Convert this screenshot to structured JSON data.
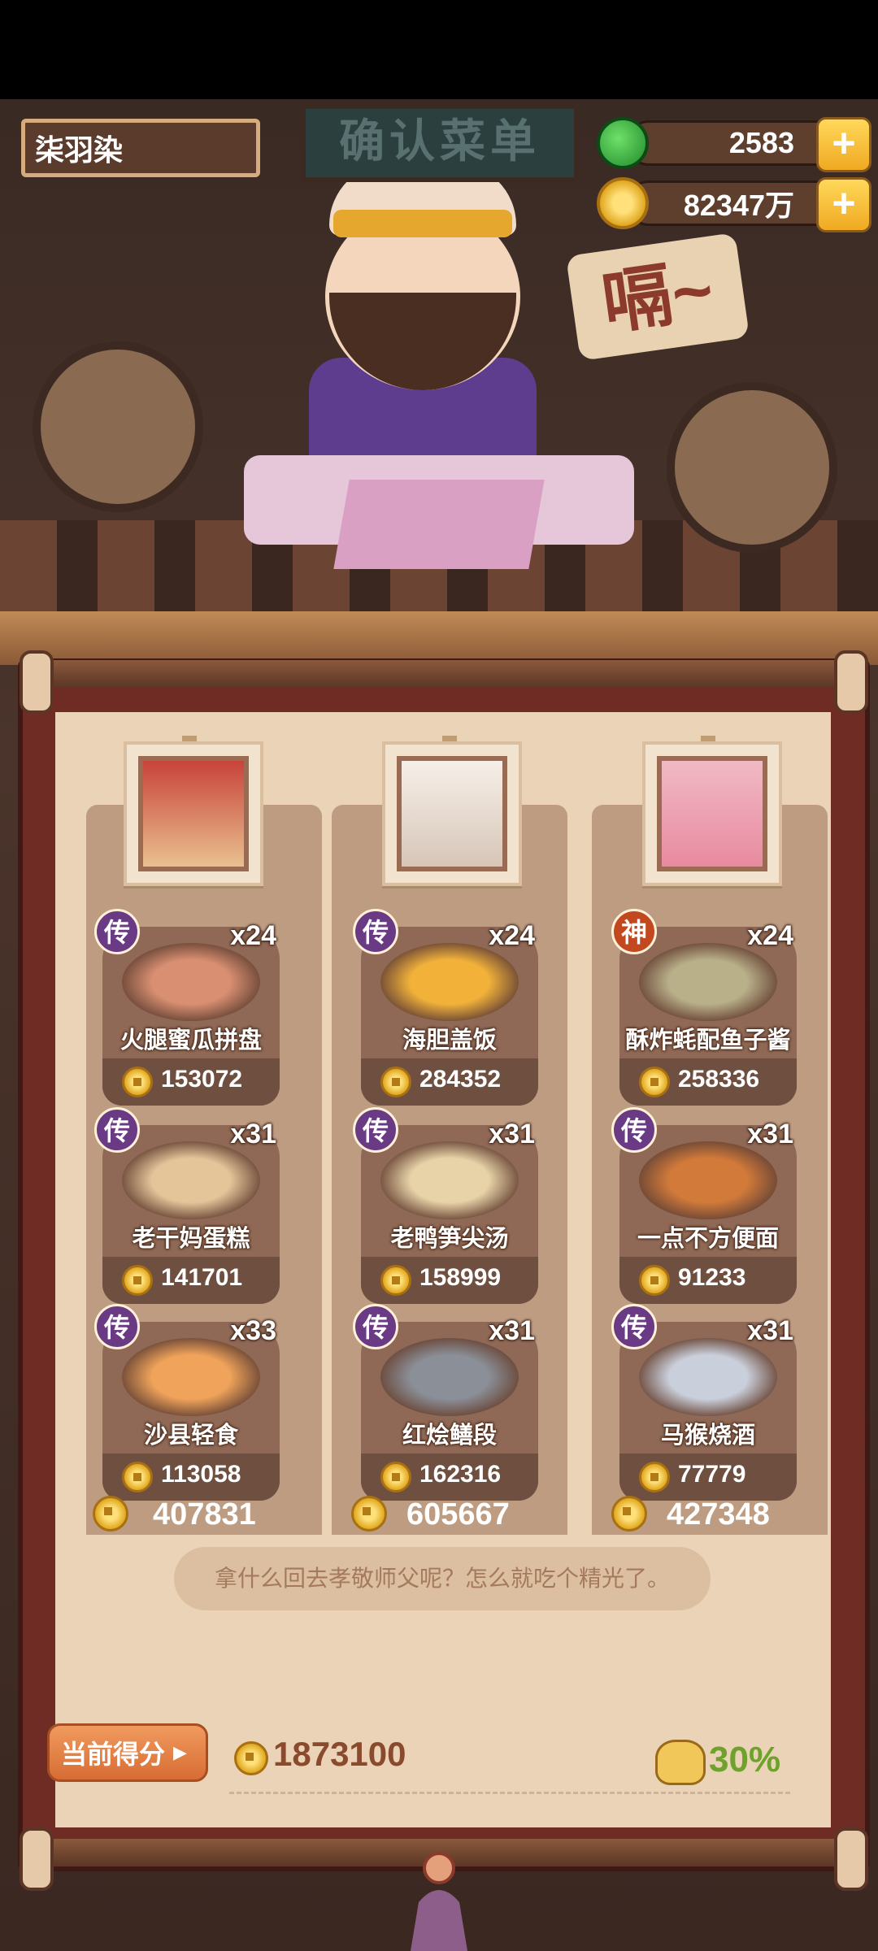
{
  "player": {
    "name": "柒羽染"
  },
  "sign": {
    "title": "确认菜单"
  },
  "resources": {
    "jade": {
      "value": "2583",
      "icon": "jade-icon"
    },
    "coins": {
      "value": "82347万",
      "icon": "coin-icon"
    },
    "plus_label": "+"
  },
  "boss": {
    "speech": "嗝~"
  },
  "columns": [
    {
      "portrait": "general-portrait",
      "dishes": [
        {
          "badge": "传",
          "badge_color": "#6a3b84",
          "count": "x24",
          "name": "火腿蜜瓜拼盘",
          "price": "153072",
          "art_color": "#d98f72"
        },
        {
          "badge": "传",
          "badge_color": "#6a3b84",
          "count": "x31",
          "name": "老干妈蛋糕",
          "price": "141701",
          "art_color": "#e4c59a"
        },
        {
          "badge": "传",
          "badge_color": "#6a3b84",
          "count": "x33",
          "name": "沙县轻食",
          "price": "113058",
          "art_color": "#f0a35a"
        }
      ],
      "total": "407831"
    },
    {
      "portrait": "white-hair-portrait",
      "dishes": [
        {
          "badge": "传",
          "badge_color": "#6a3b84",
          "count": "x24",
          "name": "海胆盖饭",
          "price": "284352",
          "art_color": "#f2b23a"
        },
        {
          "badge": "传",
          "badge_color": "#6a3b84",
          "count": "x31",
          "name": "老鸭笋尖汤",
          "price": "158999",
          "art_color": "#e8d3a8"
        },
        {
          "badge": "传",
          "badge_color": "#6a3b84",
          "count": "x31",
          "name": "红烩鳝段",
          "price": "162316",
          "art_color": "#8a8f98"
        }
      ],
      "total": "605667"
    },
    {
      "portrait": "pink-hair-portrait",
      "dishes": [
        {
          "badge": "神",
          "badge_color": "#c2481f",
          "count": "x24",
          "name": "酥炸蚝配鱼子酱",
          "price": "258336",
          "art_color": "#b9b08a"
        },
        {
          "badge": "传",
          "badge_color": "#6a3b84",
          "count": "x31",
          "name": "一点不方便面",
          "price": "91233",
          "art_color": "#d27a3a"
        },
        {
          "badge": "传",
          "badge_color": "#6a3b84",
          "count": "x31",
          "name": "马猴烧酒",
          "price": "77779",
          "art_color": "#c9cfdb"
        }
      ],
      "total": "427348"
    }
  ],
  "hint": "拿什么回去孝敬师父呢？怎么就吃个精光了。",
  "score": {
    "label": "当前得分",
    "value": "1873100",
    "percent": "30%"
  },
  "colors": {
    "accent": "#f0a922",
    "paper": "#ead3b6",
    "frame": "#6e2c24",
    "green": "#6ea22c"
  }
}
